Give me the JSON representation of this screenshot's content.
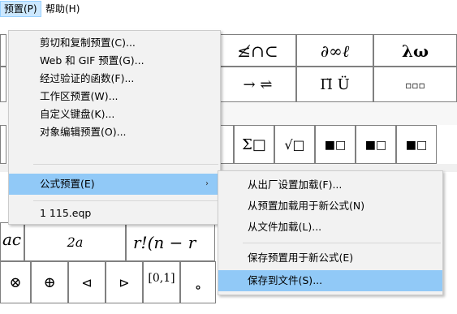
{
  "menubar": {
    "items": [
      {
        "label": "预置(P)",
        "active": true
      },
      {
        "label": "帮助(H)",
        "active": false
      }
    ]
  },
  "main_menu": {
    "items": [
      {
        "label": "剪切和复制预置(C)..."
      },
      {
        "label": "Web 和 GIF 预置(G)..."
      },
      {
        "label": "经过验证的函数(F)..."
      },
      {
        "label": "工作区预置(W)..."
      },
      {
        "label": "自定义键盘(K)..."
      },
      {
        "label": "对象编辑预置(O)..."
      },
      {
        "label": "公式预置(E)",
        "submenu_arrow": "›",
        "highlighted": true
      },
      {
        "label": "1 115.eqp"
      }
    ]
  },
  "submenu": {
    "items": [
      {
        "label": "从出厂设置加载(F)..."
      },
      {
        "label": "从预置加载用于新公式(N)"
      },
      {
        "label": "从文件加载(L)..."
      },
      {
        "label": "保存预置用于新公式(E)"
      },
      {
        "label": "保存到文件(S)...",
        "highlighted": true
      }
    ]
  },
  "toolbar": {
    "row1": [
      "≰∩⊂",
      "∂∞ℓ",
      "λω"
    ],
    "row2": [
      "→ ⇌",
      "Π̈ Ü",
      "▫▫▫"
    ],
    "row3": [
      "Σ□",
      "√□",
      "■□",
      "■□",
      "■□"
    ],
    "formula_left": "ac",
    "formula_mid": "2a",
    "formula_right": "r!(n − r",
    "bottom_symbols": [
      "⊗",
      "⊕",
      "⊲",
      "⊳",
      "[0,1]",
      "∘"
    ]
  },
  "colors": {
    "menu_highlight": "#91c9f7",
    "menubar_active": "#cce8ff"
  }
}
